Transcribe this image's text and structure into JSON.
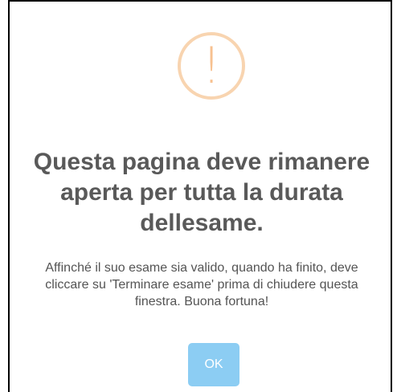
{
  "dialog": {
    "icon": "warning-exclamation-icon",
    "icon_glyph": "!",
    "icon_color": "#f7c190",
    "icon_border_color": "#f8d4b0",
    "title": "Questa pagina deve rimanere aperta per tutta la durata dellesame.",
    "message": "Affinché il suo esame sia valido, quando ha finito, deve cliccare su 'Terminare esame' prima di chiudere questa finestra. Buona fortuna!",
    "ok_label": "OK",
    "ok_color": "#8ccdf3"
  }
}
